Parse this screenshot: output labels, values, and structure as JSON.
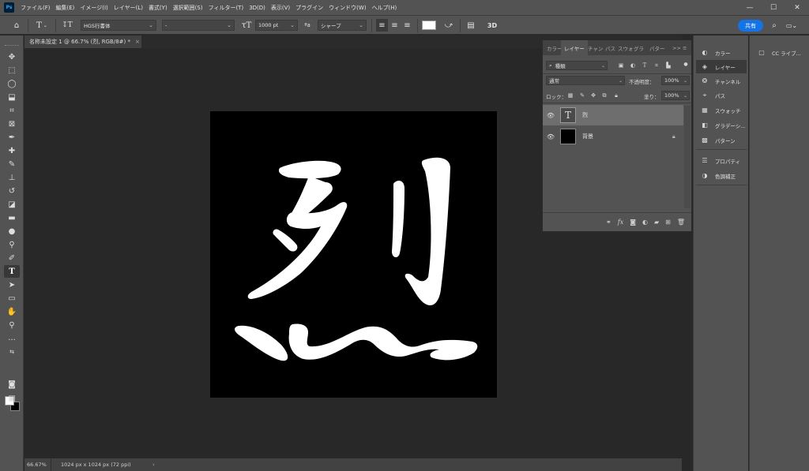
{
  "app": {
    "logo": "Ps"
  },
  "menu": [
    "ファイル(F)",
    "編集(E)",
    "イメージ(I)",
    "レイヤー(L)",
    "書式(Y)",
    "選択範囲(S)",
    "フィルター(T)",
    "3D(D)",
    "表示(V)",
    "プラグイン",
    "ウィンドウ(W)",
    "ヘルプ(H)"
  ],
  "window_controls": {
    "minimize": "—",
    "maximize": "☐",
    "close": "✕"
  },
  "options": {
    "font_family": "HGS行書体",
    "font_style": "-",
    "font_size": "1000 pt",
    "aa_label": "ªa",
    "antialias": "シャープ",
    "three_d": "3D",
    "share": "共有",
    "text_color": "#ffffff"
  },
  "document": {
    "tab_title": "名称未設定 1 @ 66.7% (烈, RGB/8#) *",
    "tab_close": "×",
    "glyph": "烈"
  },
  "status": {
    "zoom": "66.67%",
    "doc_info": "1024 px x 1024 px (72 ppi)",
    "arrow": "›"
  },
  "layers_panel": {
    "tabs": [
      "カラー",
      "レイヤー",
      "チャン",
      "パス",
      "スウォ",
      "グラ",
      "パター"
    ],
    "menu_glyph": ">> ≡",
    "filter_kind": "種類",
    "blend_mode": "通常",
    "opacity_label": "不透明度：",
    "opacity_value": "100%",
    "lock_label": "ロック：",
    "fill_label": "塗り：",
    "fill_value": "100%",
    "layers": [
      {
        "name": "烈",
        "type": "text",
        "thumb_glyph": "T",
        "selected": true
      },
      {
        "name": "背景",
        "type": "background",
        "locked": true
      }
    ]
  },
  "dock": {
    "items": [
      {
        "label": "カラー",
        "icon": "palette-icon",
        "glyph": "◐"
      },
      {
        "label": "レイヤー",
        "icon": "layers-icon",
        "glyph": "◈",
        "active": true
      },
      {
        "label": "チャンネル",
        "icon": "channels-icon",
        "glyph": "❂"
      },
      {
        "label": "パス",
        "icon": "paths-icon",
        "glyph": "⌖"
      },
      {
        "label": "スウォッチ",
        "icon": "swatches-icon",
        "glyph": "▦"
      },
      {
        "label": "グラデーシ...",
        "icon": "gradients-icon",
        "glyph": "◧"
      },
      {
        "label": "パターン",
        "icon": "patterns-icon",
        "glyph": "▩"
      },
      {
        "label": "プロパティ",
        "icon": "properties-icon",
        "glyph": "☰"
      },
      {
        "label": "色調補正",
        "icon": "adjustments-icon",
        "glyph": "◑"
      }
    ],
    "libraries": {
      "label": "CC ライブ...",
      "icon": "libraries-icon",
      "glyph": "▢"
    }
  }
}
